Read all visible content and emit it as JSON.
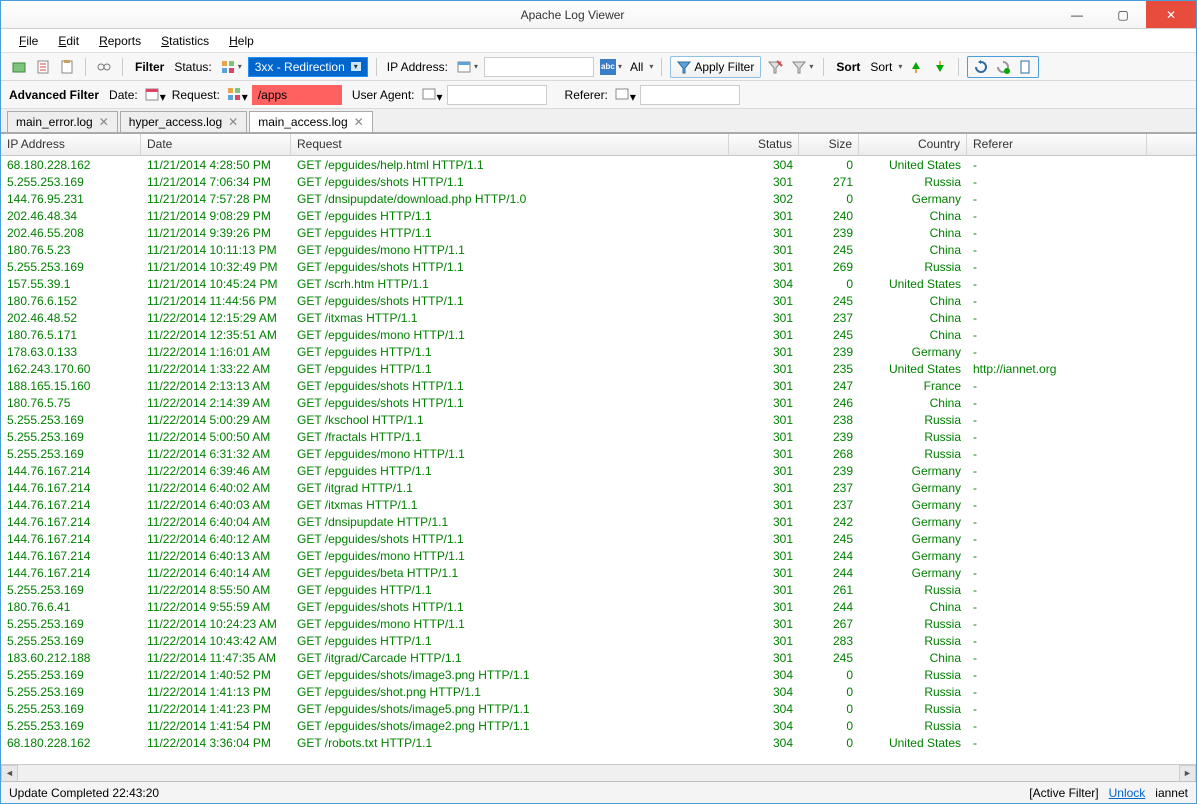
{
  "window": {
    "title": "Apache Log Viewer"
  },
  "menu": {
    "file": "File",
    "edit": "Edit",
    "reports": "Reports",
    "statistics": "Statistics",
    "help": "Help"
  },
  "toolbar1": {
    "filter_label": "Filter",
    "status_label": "Status:",
    "status_value": "3xx - Redirection",
    "ip_label": "IP Address:",
    "all_label": "All",
    "apply_filter": "Apply Filter",
    "sort_label": "Sort",
    "sort_value": "Sort"
  },
  "advfilter": {
    "label": "Advanced Filter",
    "date_label": "Date:",
    "request_label": "Request:",
    "request_value": "/apps",
    "ua_label": "User Agent:",
    "referer_label": "Referer:"
  },
  "tabs": [
    {
      "label": "main_error.log",
      "active": false
    },
    {
      "label": "hyper_access.log",
      "active": false
    },
    {
      "label": "main_access.log",
      "active": true
    }
  ],
  "columns": {
    "ip": "IP Address",
    "date": "Date",
    "request": "Request",
    "status": "Status",
    "size": "Size",
    "country": "Country",
    "referer": "Referer"
  },
  "rows": [
    {
      "ip": "68.180.228.162",
      "date": "11/21/2014 4:28:50 PM",
      "req": "GET /epguides/help.html HTTP/1.1",
      "status": "304",
      "size": "0",
      "country": "United States",
      "ref": "-"
    },
    {
      "ip": "5.255.253.169",
      "date": "11/21/2014 7:06:34 PM",
      "req": "GET /epguides/shots HTTP/1.1",
      "status": "301",
      "size": "271",
      "country": "Russia",
      "ref": "-"
    },
    {
      "ip": "144.76.95.231",
      "date": "11/21/2014 7:57:28 PM",
      "req": "GET /dnsipupdate/download.php HTTP/1.0",
      "status": "302",
      "size": "0",
      "country": "Germany",
      "ref": "-"
    },
    {
      "ip": "202.46.48.34",
      "date": "11/21/2014 9:08:29 PM",
      "req": "GET /epguides HTTP/1.1",
      "status": "301",
      "size": "240",
      "country": "China",
      "ref": "-"
    },
    {
      "ip": "202.46.55.208",
      "date": "11/21/2014 9:39:26 PM",
      "req": "GET /epguides HTTP/1.1",
      "status": "301",
      "size": "239",
      "country": "China",
      "ref": "-"
    },
    {
      "ip": "180.76.5.23",
      "date": "11/21/2014 10:11:13 PM",
      "req": "GET /epguides/mono HTTP/1.1",
      "status": "301",
      "size": "245",
      "country": "China",
      "ref": "-"
    },
    {
      "ip": "5.255.253.169",
      "date": "11/21/2014 10:32:49 PM",
      "req": "GET /epguides/shots HTTP/1.1",
      "status": "301",
      "size": "269",
      "country": "Russia",
      "ref": "-"
    },
    {
      "ip": "157.55.39.1",
      "date": "11/21/2014 10:45:24 PM",
      "req": "GET /scrh.htm HTTP/1.1",
      "status": "304",
      "size": "0",
      "country": "United States",
      "ref": "-"
    },
    {
      "ip": "180.76.6.152",
      "date": "11/21/2014 11:44:56 PM",
      "req": "GET /epguides/shots HTTP/1.1",
      "status": "301",
      "size": "245",
      "country": "China",
      "ref": "-"
    },
    {
      "ip": "202.46.48.52",
      "date": "11/22/2014 12:15:29 AM",
      "req": "GET /itxmas HTTP/1.1",
      "status": "301",
      "size": "237",
      "country": "China",
      "ref": "-"
    },
    {
      "ip": "180.76.5.171",
      "date": "11/22/2014 12:35:51 AM",
      "req": "GET /epguides/mono HTTP/1.1",
      "status": "301",
      "size": "245",
      "country": "China",
      "ref": "-"
    },
    {
      "ip": "178.63.0.133",
      "date": "11/22/2014 1:16:01 AM",
      "req": "GET /epguides HTTP/1.1",
      "status": "301",
      "size": "239",
      "country": "Germany",
      "ref": "-"
    },
    {
      "ip": "162.243.170.60",
      "date": "11/22/2014 1:33:22 AM",
      "req": "GET /epguides HTTP/1.1",
      "status": "301",
      "size": "235",
      "country": "United States",
      "ref": "http://iannet.org"
    },
    {
      "ip": "188.165.15.160",
      "date": "11/22/2014 2:13:13 AM",
      "req": "GET /epguides/shots HTTP/1.1",
      "status": "301",
      "size": "247",
      "country": "France",
      "ref": "-"
    },
    {
      "ip": "180.76.5.75",
      "date": "11/22/2014 2:14:39 AM",
      "req": "GET /epguides/shots HTTP/1.1",
      "status": "301",
      "size": "246",
      "country": "China",
      "ref": "-"
    },
    {
      "ip": "5.255.253.169",
      "date": "11/22/2014 5:00:29 AM",
      "req": "GET /kschool HTTP/1.1",
      "status": "301",
      "size": "238",
      "country": "Russia",
      "ref": "-"
    },
    {
      "ip": "5.255.253.169",
      "date": "11/22/2014 5:00:50 AM",
      "req": "GET /fractals HTTP/1.1",
      "status": "301",
      "size": "239",
      "country": "Russia",
      "ref": "-"
    },
    {
      "ip": "5.255.253.169",
      "date": "11/22/2014 6:31:32 AM",
      "req": "GET /epguides/mono HTTP/1.1",
      "status": "301",
      "size": "268",
      "country": "Russia",
      "ref": "-"
    },
    {
      "ip": "144.76.167.214",
      "date": "11/22/2014 6:39:46 AM",
      "req": "GET /epguides HTTP/1.1",
      "status": "301",
      "size": "239",
      "country": "Germany",
      "ref": "-"
    },
    {
      "ip": "144.76.167.214",
      "date": "11/22/2014 6:40:02 AM",
      "req": "GET /itgrad HTTP/1.1",
      "status": "301",
      "size": "237",
      "country": "Germany",
      "ref": "-"
    },
    {
      "ip": "144.76.167.214",
      "date": "11/22/2014 6:40:03 AM",
      "req": "GET /itxmas HTTP/1.1",
      "status": "301",
      "size": "237",
      "country": "Germany",
      "ref": "-"
    },
    {
      "ip": "144.76.167.214",
      "date": "11/22/2014 6:40:04 AM",
      "req": "GET /dnsipupdate HTTP/1.1",
      "status": "301",
      "size": "242",
      "country": "Germany",
      "ref": "-"
    },
    {
      "ip": "144.76.167.214",
      "date": "11/22/2014 6:40:12 AM",
      "req": "GET /epguides/shots HTTP/1.1",
      "status": "301",
      "size": "245",
      "country": "Germany",
      "ref": "-"
    },
    {
      "ip": "144.76.167.214",
      "date": "11/22/2014 6:40:13 AM",
      "req": "GET /epguides/mono HTTP/1.1",
      "status": "301",
      "size": "244",
      "country": "Germany",
      "ref": "-"
    },
    {
      "ip": "144.76.167.214",
      "date": "11/22/2014 6:40:14 AM",
      "req": "GET /epguides/beta HTTP/1.1",
      "status": "301",
      "size": "244",
      "country": "Germany",
      "ref": "-"
    },
    {
      "ip": "5.255.253.169",
      "date": "11/22/2014 8:55:50 AM",
      "req": "GET /epguides HTTP/1.1",
      "status": "301",
      "size": "261",
      "country": "Russia",
      "ref": "-"
    },
    {
      "ip": "180.76.6.41",
      "date": "11/22/2014 9:55:59 AM",
      "req": "GET /epguides/shots HTTP/1.1",
      "status": "301",
      "size": "244",
      "country": "China",
      "ref": "-"
    },
    {
      "ip": "5.255.253.169",
      "date": "11/22/2014 10:24:23 AM",
      "req": "GET /epguides/mono HTTP/1.1",
      "status": "301",
      "size": "267",
      "country": "Russia",
      "ref": "-"
    },
    {
      "ip": "5.255.253.169",
      "date": "11/22/2014 10:43:42 AM",
      "req": "GET /epguides HTTP/1.1",
      "status": "301",
      "size": "283",
      "country": "Russia",
      "ref": "-"
    },
    {
      "ip": "183.60.212.188",
      "date": "11/22/2014 11:47:35 AM",
      "req": "GET /itgrad/Carcade HTTP/1.1",
      "status": "301",
      "size": "245",
      "country": "China",
      "ref": "-"
    },
    {
      "ip": "5.255.253.169",
      "date": "11/22/2014 1:40:52 PM",
      "req": "GET /epguides/shots/image3.png HTTP/1.1",
      "status": "304",
      "size": "0",
      "country": "Russia",
      "ref": "-"
    },
    {
      "ip": "5.255.253.169",
      "date": "11/22/2014 1:41:13 PM",
      "req": "GET /epguides/shot.png HTTP/1.1",
      "status": "304",
      "size": "0",
      "country": "Russia",
      "ref": "-"
    },
    {
      "ip": "5.255.253.169",
      "date": "11/22/2014 1:41:23 PM",
      "req": "GET /epguides/shots/image5.png HTTP/1.1",
      "status": "304",
      "size": "0",
      "country": "Russia",
      "ref": "-"
    },
    {
      "ip": "5.255.253.169",
      "date": "11/22/2014 1:41:54 PM",
      "req": "GET /epguides/shots/image2.png HTTP/1.1",
      "status": "304",
      "size": "0",
      "country": "Russia",
      "ref": "-"
    },
    {
      "ip": "68.180.228.162",
      "date": "11/22/2014 3:36:04 PM",
      "req": "GET /robots.txt HTTP/1.1",
      "status": "304",
      "size": "0",
      "country": "United States",
      "ref": "-"
    }
  ],
  "statusbar": {
    "left": "Update Completed 22:43:20",
    "active_filter": "[Active Filter]",
    "unlock": "Unlock",
    "user": "iannet"
  }
}
